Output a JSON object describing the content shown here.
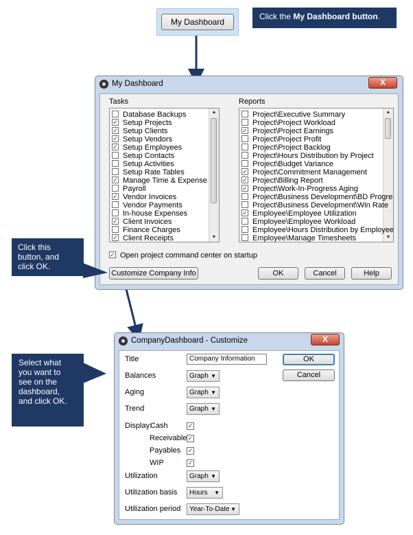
{
  "top": {
    "dashboard_button": "My Dashboard",
    "callout_prefix": "Click the ",
    "callout_bold": "My Dashboard",
    "callout_button_word": "button",
    "callout_suffix": "."
  },
  "callouts": {
    "customize": [
      "Click this",
      "button, and",
      "click OK."
    ],
    "select": [
      "Select what",
      "you want to",
      "see on the",
      "dashboard,",
      "and click OK."
    ]
  },
  "dashboard": {
    "title": "My Dashboard",
    "close": "X",
    "tasks_label": "Tasks",
    "reports_label": "Reports",
    "tasks": [
      {
        "label": "Database Backups",
        "checked": false
      },
      {
        "label": "Setup Projects",
        "checked": true
      },
      {
        "label": "Setup Clients",
        "checked": true
      },
      {
        "label": "Setup Vendors",
        "checked": true
      },
      {
        "label": "Setup Employees",
        "checked": true
      },
      {
        "label": "Setup Contacts",
        "checked": false
      },
      {
        "label": "Setup Activities",
        "checked": false
      },
      {
        "label": "Setup Rate Tables",
        "checked": false
      },
      {
        "label": "Manage Time & Expense",
        "checked": true
      },
      {
        "label": "Payroll",
        "checked": false
      },
      {
        "label": "Vendor Invoices",
        "checked": true
      },
      {
        "label": "Vendor Payments",
        "checked": false
      },
      {
        "label": "In-house Expenses",
        "checked": false
      },
      {
        "label": "Client Invoices",
        "checked": true
      },
      {
        "label": "Finance Charges",
        "checked": false
      },
      {
        "label": "Client Receipts",
        "checked": true
      }
    ],
    "reports": [
      {
        "label": "Project\\Executive Summary",
        "checked": false
      },
      {
        "label": "Project\\Project Workload",
        "checked": false
      },
      {
        "label": "Project\\Project Earnings",
        "checked": true
      },
      {
        "label": "Project\\Project Profit",
        "checked": false
      },
      {
        "label": "Project\\Project Backlog",
        "checked": false
      },
      {
        "label": "Project\\Hours Distribution by Project",
        "checked": false
      },
      {
        "label": "Project\\Budget Variance",
        "checked": false
      },
      {
        "label": "Project\\Commitment Management",
        "checked": true
      },
      {
        "label": "Project\\Billing Report",
        "checked": true
      },
      {
        "label": "Project\\Work-In-Progress Aging",
        "checked": true
      },
      {
        "label": "Project\\Business Development\\BD Progress",
        "checked": false
      },
      {
        "label": "Project\\Business Development\\Win Rate",
        "checked": false
      },
      {
        "label": "Employee\\Employee Utilization",
        "checked": true
      },
      {
        "label": "Employee\\Employee Workload",
        "checked": false
      },
      {
        "label": "Employee\\Hours Distribution by Employee",
        "checked": false
      },
      {
        "label": "Employee\\Manage Timesheets",
        "checked": false
      }
    ],
    "startup_label": "Open project command center on startup",
    "startup_checked": true,
    "customize_button": "Customize Company Info",
    "ok": "OK",
    "cancel": "Cancel",
    "help": "Help"
  },
  "customize": {
    "title": "CompanyDashboard  -  Customize",
    "close": "X",
    "title_label": "Title",
    "title_value": "Company Information",
    "ok": "OK",
    "cancel": "Cancel",
    "balances_label": "Balances",
    "balances_value": "Graph",
    "aging_label": "Aging",
    "aging_value": "Graph",
    "trend_label": "Trend",
    "trend_value": "Graph",
    "display_label": "Display:",
    "display_items": [
      {
        "label": "Cash",
        "checked": true
      },
      {
        "label": "Receivables",
        "checked": true
      },
      {
        "label": "Payables",
        "checked": true
      },
      {
        "label": "WIP",
        "checked": true
      }
    ],
    "utilization_label": "Utilization",
    "utilization_value": "Graph",
    "basis_label": "Utilization basis",
    "basis_value": "Hours",
    "period_label": "Utilization period",
    "period_value": "Year-To-Date"
  },
  "colors": {
    "callout": "#1f3864",
    "arrow": "#1f3864"
  }
}
